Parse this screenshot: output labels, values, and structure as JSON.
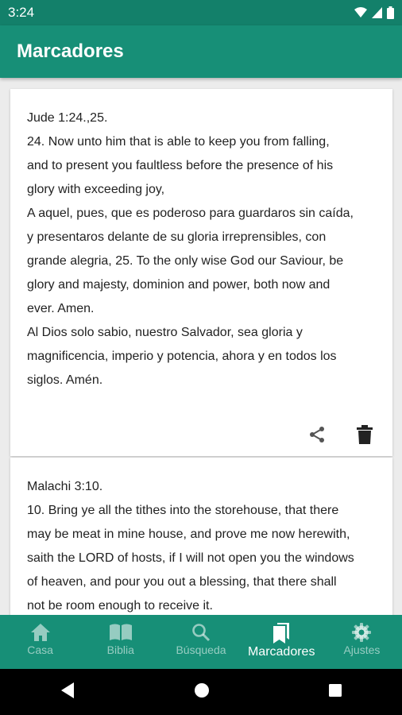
{
  "status_bar": {
    "time": "3:24"
  },
  "app_bar": {
    "title": "Marcadores"
  },
  "bookmarks": [
    {
      "lines": [
        "Jude 1:24.,25.",
        "24. Now unto him that is able to keep you from falling,",
        "and to present you faultless before the presence of his",
        "glory with exceeding joy,",
        "A aquel, pues, que es poderoso para guardaros sin caída,",
        "y presentaros delante de su gloria irreprensibles, con",
        "grande alegria, 25. To the only wise God our Saviour, be",
        "glory and majesty, dominion and power, both now and",
        "ever. Amen.",
        "Al Dios solo sabio, nuestro Salvador, sea gloria y",
        "magnificencia, imperio y potencia, ahora y en todos los",
        "siglos. Amén."
      ]
    },
    {
      "lines": [
        "Malachi 3:10.",
        "10. Bring ye all the tithes into the storehouse, that there",
        "may be meat in mine house, and prove me now herewith,",
        "saith the LORD of hosts, if I will not open you the windows",
        "of heaven, and pour you out a blessing, that there shall",
        "not be room enough to receive it."
      ]
    }
  ],
  "bottom_nav": {
    "items": [
      {
        "label": "Casa",
        "icon": "home-icon"
      },
      {
        "label": "Biblia",
        "icon": "book-icon"
      },
      {
        "label": "Búsqueda",
        "icon": "search-icon"
      },
      {
        "label": "Marcadores",
        "icon": "bookmarks-icon"
      },
      {
        "label": "Ajustes",
        "icon": "gear-icon"
      }
    ],
    "active": "Marcadores"
  },
  "colors": {
    "status_bar": "#13806a",
    "primary": "#178f77",
    "background": "#ececec",
    "icon_gray": "#555555"
  }
}
